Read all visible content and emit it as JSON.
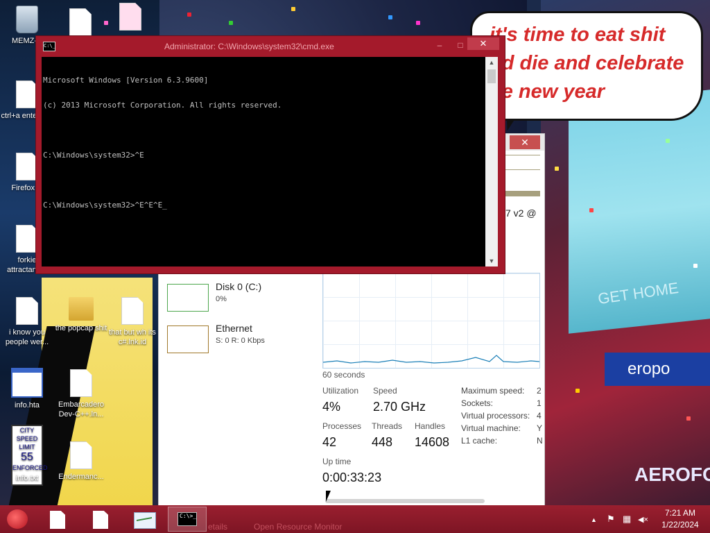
{
  "cmd_window": {
    "title": "Administrator: C:\\Windows\\system32\\cmd.exe",
    "icon": "console-icon",
    "icon_text": "C:\\_",
    "lines": [
      "Microsoft Windows [Version 6.3.9600]",
      "(c) 2013 Microsoft Corporation. All rights reserved.",
      "",
      "C:\\Windows\\system32>^E",
      "",
      "C:\\Windows\\system32>^E^E^E_"
    ],
    "minimize_glyph": "–",
    "maximize_glyph": "□",
    "close_glyph": "✕"
  },
  "speech_bubble": {
    "line1": "it's time to eat shit",
    "line2": "nd die and celebrate",
    "line3": "he new year"
  },
  "desktop_icons": [
    {
      "label": "MEMZ-D",
      "icon": "recycle-bin-icon"
    },
    {
      "label": "ctrl+a enter.lnk.",
      "icon": "file-icon"
    },
    {
      "label": "Firefox.ln",
      "icon": "file-icon"
    },
    {
      "label": "forkie attractant....",
      "icon": "file-icon"
    },
    {
      "label": "i know you people wer...",
      "icon": "file-icon"
    },
    {
      "label": "the popcap shit",
      "icon": "folder-icon"
    },
    {
      "label": "that but wh its c#.lnk.id",
      "icon": "file-icon"
    },
    {
      "label": "info.hta",
      "icon": "hta-icon"
    },
    {
      "label": "Embarcadero Dev-C++.ln...",
      "icon": "file-icon"
    },
    {
      "label": "info.txt",
      "icon": "speed-sign-icon"
    },
    {
      "label": "Endermanc...",
      "icon": "file-icon"
    }
  ],
  "speed_sign_text": [
    "CITY",
    "SPEED",
    "LIMIT",
    "55",
    "ENFORCED"
  ],
  "task_manager": {
    "close_glyph": "✕",
    "cpu_name_fragment": "7 v2 @",
    "resources": [
      {
        "name": "Disk 0 (C:)",
        "sub": "0%",
        "color": "#4da64d"
      },
      {
        "name": "Ethernet",
        "sub": "S: 0 R: 0 Kbps",
        "color": "#a0782a"
      }
    ],
    "graph_label": "60 seconds",
    "graph_color": "#1a7fb7",
    "stats": {
      "utilization_label": "Utilization",
      "utilization": "4%",
      "speed_label": "Speed",
      "speed": "2.70 GHz",
      "processes_label": "Processes",
      "processes": "42",
      "threads_label": "Threads",
      "threads": "448",
      "handles_label": "Handles",
      "handles": "14608",
      "uptime_label": "Up time",
      "uptime": "0:00:33:23"
    },
    "right_labels": [
      "Maximum speed:",
      "Sockets:",
      "Virtual processors:",
      "Virtual machine:",
      "L1 cache:"
    ],
    "right_values": [
      "2",
      "1",
      "4",
      "Y",
      "N"
    ],
    "bottom_links": [
      "etails",
      "Open Resource Monitor"
    ]
  },
  "taskbar": {
    "start_icon": "start-orb-icon",
    "buttons": [
      {
        "icon": "file-icon",
        "active": false
      },
      {
        "icon": "file-icon",
        "active": false
      },
      {
        "icon": "performance-monitor-icon",
        "active": false
      },
      {
        "icon": "console-icon",
        "active": true
      }
    ],
    "cmd_icon_text": "C:\\>_",
    "tray": {
      "chevron": "▲",
      "flag": "⚑",
      "network": "▦",
      "volume": "◀×",
      "time": "7:21 AM",
      "date": "1/22/2024"
    }
  },
  "wallpaper": {
    "billboard_1": "GET HOME",
    "billboard_2": "eropo",
    "billboard_3": "AEROFOS",
    "accent_red": "#a41a2b"
  }
}
